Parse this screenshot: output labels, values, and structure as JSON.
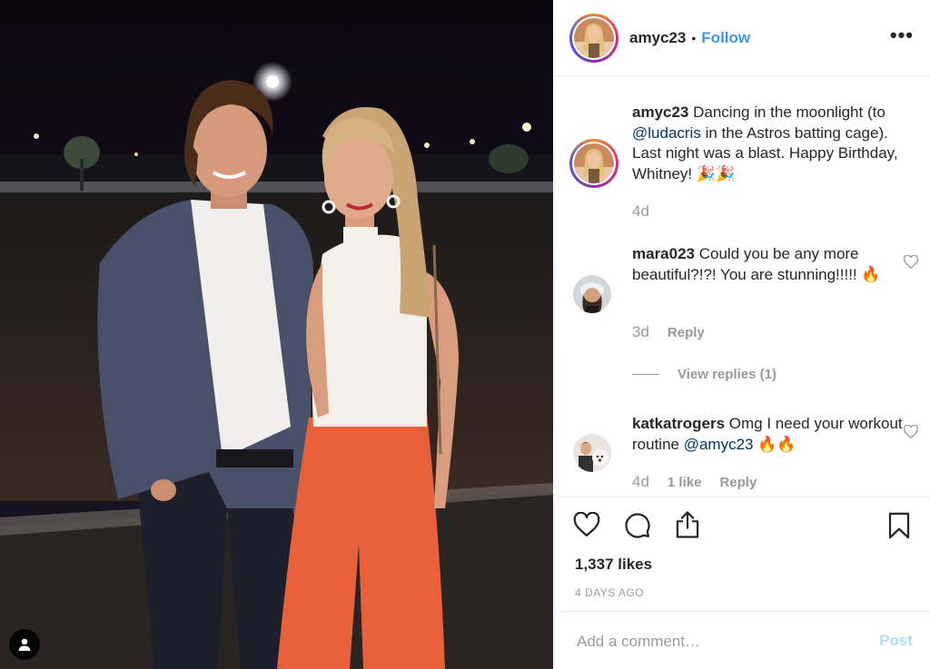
{
  "photo": {
    "user_tag_icon": "person-icon"
  },
  "header": {
    "username": "amyc23",
    "separator": "•",
    "follow_label": "Follow",
    "more_label": "•••"
  },
  "caption": {
    "username": "amyc23",
    "text_1": " Dancing in the moonlight (to ",
    "mention": "@ludacris",
    "text_2": " in the Astros batting cage). Last night was a blast. Happy Birthday, Whitney! 🎉🎉",
    "time": "4d"
  },
  "comments": [
    {
      "username": "mara023",
      "text": " Could you be any more beautiful?!?! You are stunning!!!!! 🔥",
      "time": "3d",
      "reply_label": "Reply",
      "view_replies_label": "View replies (1)"
    },
    {
      "username": "katkatrogers",
      "text_1": " Omg I need your workout routine ",
      "mention": "@amyc23",
      "text_2": " 🔥🔥",
      "time": "4d",
      "likes_label": "1 like",
      "reply_label": "Reply"
    }
  ],
  "actions": {
    "like_icon": "heart-icon",
    "comment_icon": "comment-icon",
    "share_icon": "share-icon",
    "save_icon": "bookmark-icon"
  },
  "likes": "1,337 likes",
  "posted_ago": "4 DAYS AGO",
  "add_comment": {
    "placeholder": "Add a comment…",
    "post_label": "Post"
  },
  "colors": {
    "link_blue": "#3897f0",
    "mention_blue": "#003569",
    "muted": "#999999",
    "text": "#262626",
    "post_disabled": "#b3dbff"
  }
}
